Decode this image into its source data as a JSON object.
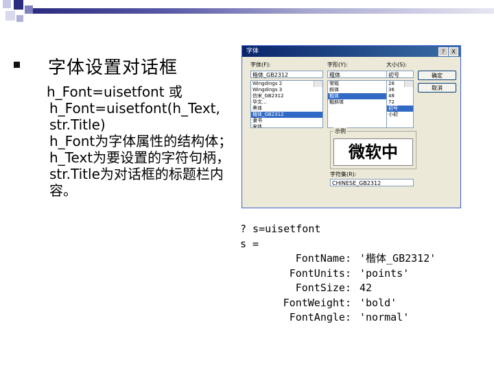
{
  "heading": "字体设置对话框",
  "lines": {
    "l1": "h_Font=uisetfont  或",
    "l2": "h_Font=uisetfont(h_Text,",
    "l3": "str.Title)",
    "l4": "h_Font为字体属性的结构体；h_Text为要设置的字符句柄，str.Title为对话框的标题栏内容。"
  },
  "dialog": {
    "title": "字体",
    "help_btn": "?",
    "close_btn": "X",
    "font_label": "字体(F):",
    "font_value": "楷体_GB2312",
    "style_label": "字形(Y):",
    "style_value": "粗体",
    "size_label": "大小(S):",
    "size_value": "初号",
    "font_list": [
      "Wingdings 2",
      "Wingdings 3",
      "仿宋_GB2312",
      "华文...",
      "黑体",
      "楷体_GB2312",
      "隶书",
      "宋体",
      "新宋体"
    ],
    "font_selected": 5,
    "style_list": [
      "常规",
      "斜体",
      "粗体",
      "粗斜体"
    ],
    "style_selected": 2,
    "size_list": [
      "28",
      "36",
      "48",
      "72",
      "初号",
      "小初"
    ],
    "size_selected": 4,
    "ok": "确定",
    "cancel": "取消",
    "sample_label": "示例",
    "sample_text": "微软中",
    "script_label": "字符集(R):",
    "script_value": "CHINESE_GB2312"
  },
  "code": {
    "l1": "? s=uisetfont",
    "l2": "s =",
    "rows": [
      {
        "k": "FontName:",
        "v": "'楷体_GB2312'"
      },
      {
        "k": "FontUnits:",
        "v": "'points'"
      },
      {
        "k": "FontSize:",
        "v": "42"
      },
      {
        "k": "FontWeight:",
        "v": "'bold'"
      },
      {
        "k": "FontAngle:",
        "v": "'normal'"
      }
    ]
  }
}
